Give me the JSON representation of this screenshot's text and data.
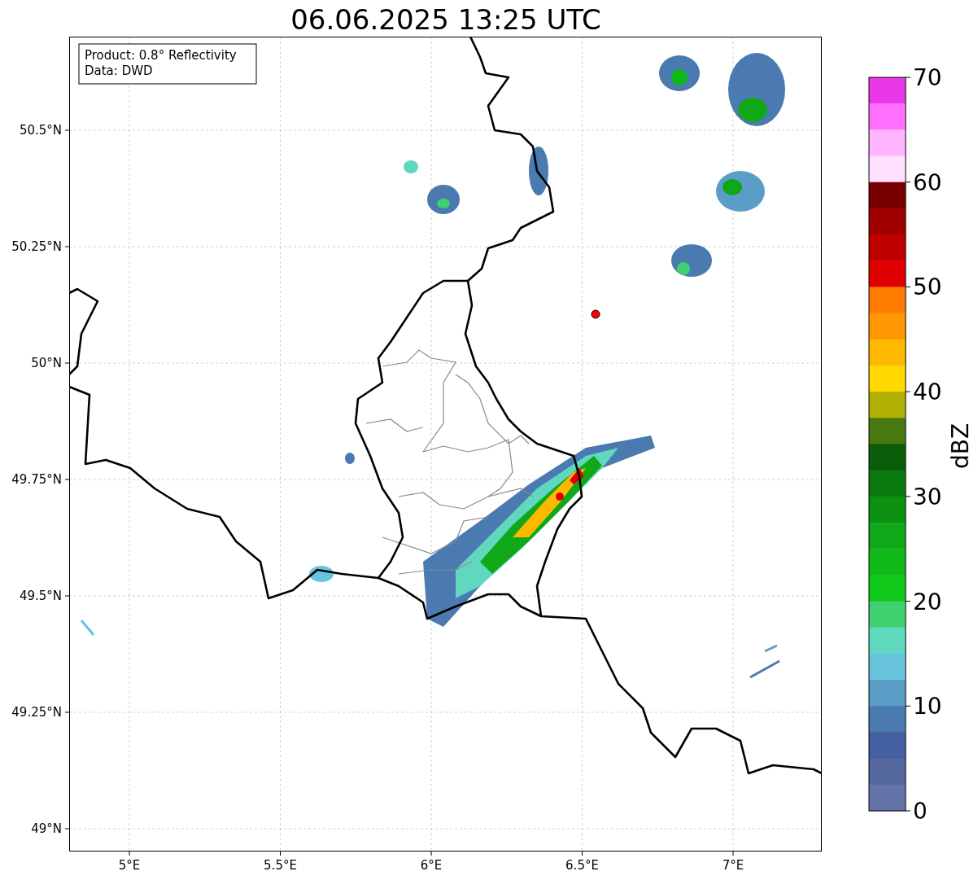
{
  "title": "06.06.2025 13:25 UTC",
  "legend": [
    "Product: 0.8° Reflectivity",
    "Data: DWD"
  ],
  "y_ticks": [
    "50.5°N",
    "50.25°N",
    "50°N",
    "49.75°N",
    "49.5°N",
    "49.25°N",
    "49°N"
  ],
  "x_ticks": [
    "5°E",
    "5.5°E",
    "6°E",
    "6.5°E",
    "7°E"
  ],
  "colorbar": {
    "label": "dBZ",
    "ticks": [
      "70",
      "60",
      "50",
      "40",
      "30",
      "20",
      "10",
      "0"
    ],
    "bins": [
      {
        "color": "#e838e8"
      },
      {
        "color": "#ff70ff"
      },
      {
        "color": "#ffb4ff"
      },
      {
        "color": "#ffe0ff"
      },
      {
        "color": "#780000"
      },
      {
        "color": "#a00000"
      },
      {
        "color": "#c00000"
      },
      {
        "color": "#e00000"
      },
      {
        "color": "#ff7c00"
      },
      {
        "color": "#ff9800"
      },
      {
        "color": "#ffb800"
      },
      {
        "color": "#ffd800"
      },
      {
        "color": "#b0b000"
      },
      {
        "color": "#487810"
      },
      {
        "color": "#0a5e0a"
      },
      {
        "color": "#0a7a10"
      },
      {
        "color": "#0c9010"
      },
      {
        "color": "#10a818"
      },
      {
        "color": "#10b818"
      },
      {
        "color": "#10c818"
      },
      {
        "color": "#40d070"
      },
      {
        "color": "#60d8c0"
      },
      {
        "color": "#68c4dc"
      },
      {
        "color": "#5a9ec8"
      },
      {
        "color": "#4a7ab0"
      },
      {
        "color": "#4460a0"
      },
      {
        "color": "#5568a0"
      },
      {
        "color": "#6574a8"
      }
    ]
  }
}
